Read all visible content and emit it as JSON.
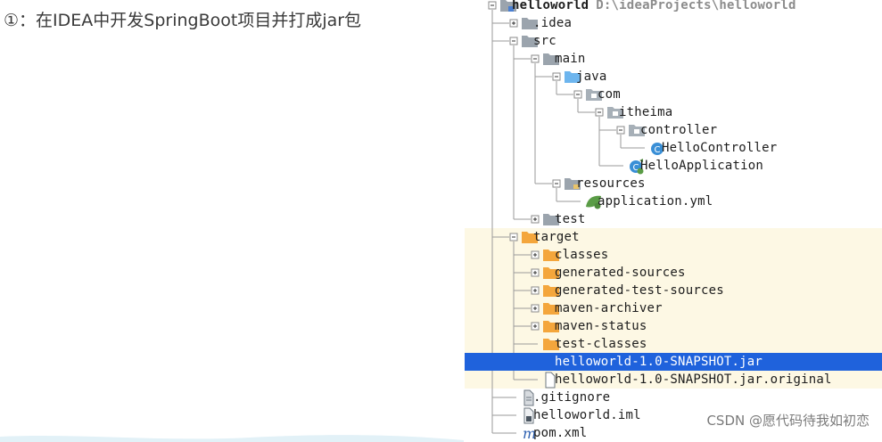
{
  "instruction": {
    "text": "①：在IDEA中开发SpringBoot项目并打成jar包"
  },
  "project_tree": {
    "selected_item": "helloworld-1.0-SNAPSHOT.jar",
    "items": [
      {
        "label": "helloworld",
        "hint": "D:\\ideaProjects\\helloworld",
        "depth": 0,
        "expander": "expanded",
        "icon": "module-folder-icon",
        "bold": true
      },
      {
        "label": ".idea",
        "depth": 1,
        "expander": "collapsed",
        "icon": "folder-icon"
      },
      {
        "label": "src",
        "depth": 1,
        "expander": "expanded",
        "icon": "folder-icon"
      },
      {
        "label": "main",
        "depth": 2,
        "expander": "expanded",
        "icon": "folder-icon"
      },
      {
        "label": "java",
        "depth": 3,
        "expander": "expanded",
        "icon": "source-folder-icon"
      },
      {
        "label": "com",
        "depth": 4,
        "expander": "expanded",
        "icon": "package-icon"
      },
      {
        "label": "itheima",
        "depth": 5,
        "expander": "expanded",
        "icon": "package-icon"
      },
      {
        "label": "controller",
        "depth": 6,
        "expander": "expanded",
        "icon": "package-icon"
      },
      {
        "label": "HelloController",
        "depth": 7,
        "expander": "none",
        "icon": "java-class-icon"
      },
      {
        "label": "HelloApplication",
        "depth": 6,
        "expander": "none",
        "icon": "spring-boot-class-icon"
      },
      {
        "label": "resources",
        "depth": 3,
        "expander": "expanded",
        "icon": "resources-folder-icon"
      },
      {
        "label": "application.yml",
        "depth": 4,
        "expander": "none",
        "icon": "spring-config-icon"
      },
      {
        "label": "test",
        "depth": 2,
        "expander": "collapsed",
        "icon": "folder-icon"
      },
      {
        "label": "target",
        "depth": 1,
        "expander": "expanded",
        "icon": "excluded-folder-icon"
      },
      {
        "label": "classes",
        "depth": 2,
        "expander": "collapsed",
        "icon": "excluded-folder-icon"
      },
      {
        "label": "generated-sources",
        "depth": 2,
        "expander": "collapsed",
        "icon": "excluded-folder-icon"
      },
      {
        "label": "generated-test-sources",
        "depth": 2,
        "expander": "collapsed",
        "icon": "excluded-folder-icon"
      },
      {
        "label": "maven-archiver",
        "depth": 2,
        "expander": "collapsed",
        "icon": "excluded-folder-icon"
      },
      {
        "label": "maven-status",
        "depth": 2,
        "expander": "collapsed",
        "icon": "excluded-folder-icon"
      },
      {
        "label": "test-classes",
        "depth": 2,
        "expander": "none",
        "icon": "excluded-folder-icon"
      },
      {
        "label": "helloworld-1.0-SNAPSHOT.jar",
        "depth": 2,
        "expander": "none",
        "icon": "jar-file-icon",
        "selected": true
      },
      {
        "label": "helloworld-1.0-SNAPSHOT.jar.original",
        "depth": 2,
        "expander": "none",
        "icon": "text-file-icon"
      },
      {
        "label": ".gitignore",
        "depth": 1,
        "expander": "none",
        "icon": "gitignore-file-icon"
      },
      {
        "label": "helloworld.iml",
        "depth": 1,
        "expander": "none",
        "icon": "iml-file-icon"
      },
      {
        "label": "pom.xml",
        "depth": 1,
        "expander": "none",
        "icon": "maven-pom-icon"
      }
    ]
  },
  "colors": {
    "selection": "#1f62dc",
    "excluded_background": "#fdf8e4",
    "folder_gray": "#9ba4ad",
    "folder_orange": "#f4a63c",
    "source_blue": "#6db5ee",
    "class_blue": "#3a8fd6",
    "spring_green": "#5a9c46"
  },
  "watermark": {
    "text": "CSDN @愿代码待我如初恋"
  }
}
